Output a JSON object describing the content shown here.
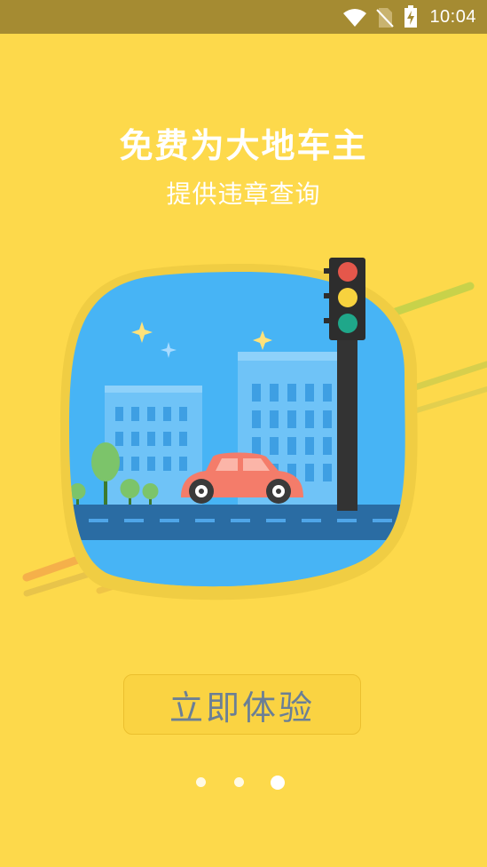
{
  "status_bar": {
    "time": "10:04",
    "icons": [
      "wifi-icon",
      "no-sim-icon",
      "battery-charging-icon"
    ]
  },
  "onboarding": {
    "title": "免费为大地车主",
    "subtitle": "提供违章查询",
    "illustration": "city-street-car-traffic-light",
    "cta_label": "立即体验",
    "pager": {
      "page_count": 3,
      "active_index": 2
    }
  },
  "colors": {
    "background": "#FDD94B",
    "status_bar": "#A58B32",
    "button_text": "#6B7F95",
    "sky": "#47B4F5",
    "car": "#F47C6A"
  }
}
